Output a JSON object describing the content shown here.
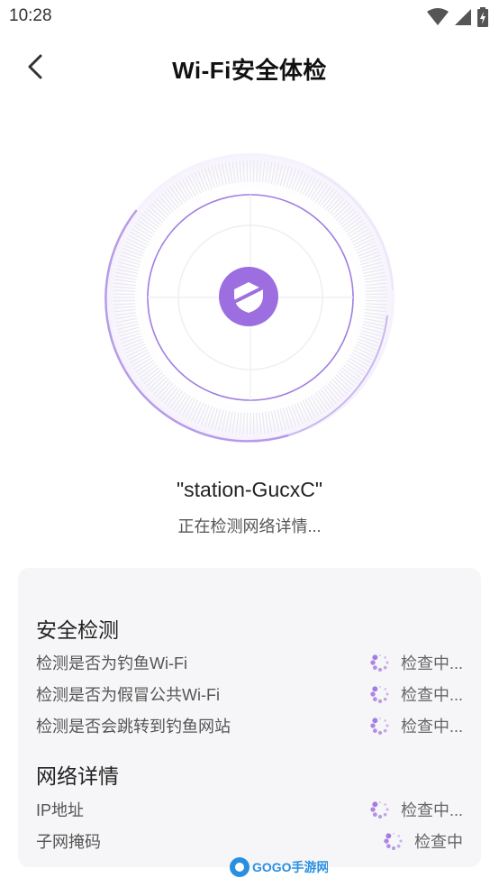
{
  "status_bar": {
    "time": "10:28"
  },
  "header": {
    "title": "Wi-Fi安全体检"
  },
  "network": {
    "ssid": "\"station-GucxC\"",
    "status": "正在检测网络详情..."
  },
  "security": {
    "title": "安全检测",
    "items": [
      {
        "label": "检测是否为钓鱼Wi-Fi",
        "status": "检查中..."
      },
      {
        "label": "检测是否为假冒公共Wi-Fi",
        "status": "检查中..."
      },
      {
        "label": "检测是否会跳转到钓鱼网站",
        "status": "检查中..."
      }
    ]
  },
  "details": {
    "title": "网络详情",
    "items": [
      {
        "label": "IP地址",
        "status": "检查中..."
      },
      {
        "label": "子网掩码",
        "status": "检查中"
      }
    ]
  },
  "watermark": {
    "text": "GOGO手游网"
  },
  "colors": {
    "accent": "#9c6ee0",
    "card_bg": "#f6f6f8"
  }
}
